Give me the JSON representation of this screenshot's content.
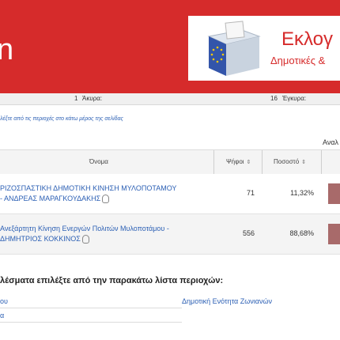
{
  "header": {
    "brand_letter": "n",
    "banner_title": "Εκλογ",
    "banner_subtitle": "Δημοτικές &"
  },
  "summary": {
    "left_value": "1",
    "invalid_label": "Άκυρα:",
    "mid_value": "16",
    "valid_label": "Έγκυρα:"
  },
  "hint_text": "λέξτε από τις περιοχές στο κάτω μέρος της σελίδας",
  "more_link": "Αναλ",
  "table": {
    "headers": {
      "name": "Όνομα",
      "votes": "Ψήφοι",
      "percent": "Ποσοστό",
      "sort_glyph": "⇕"
    },
    "rows": [
      {
        "line1": "ΡΙΖΟΣΠΑΣΤΙΚΗ ΔΗΜΟΤΙΚΗ ΚΙΝΗΣΗ ΜΥΛΟΠΟΤΑΜΟΥ",
        "line2": "- ΑΝΔΡΕΑΣ ΜΑΡΑΓΚΟΥΔΑΚΗΣ",
        "votes": "71",
        "percent": "11,32%",
        "share": 11.32
      },
      {
        "line1": "Ανεξάρτητη Κίνηση Ενεργών Πολιτών Μυλοποτάμου -",
        "line2": "ΔΗΜΗΤΡΙΟΣ ΚΟΚΚΙΝΟΣ",
        "votes": "556",
        "percent": "88,68%",
        "share": 88.68
      }
    ]
  },
  "regions_heading": "λέσματα επιλέξτε από την παρακάτω λίστα περιοχών:",
  "regions": {
    "left_1": "ου",
    "right_1": "Δημοτική Ενότητα Ζωνιανών",
    "left_2": "α"
  },
  "colors": {
    "brand_red": "#d62b2b",
    "link_blue": "#2b5fb4",
    "bar": "#a86a6a"
  },
  "icons": {
    "ballot": "ballot-box-icon",
    "audio": "ear-icon",
    "sort": "sort-icon"
  }
}
